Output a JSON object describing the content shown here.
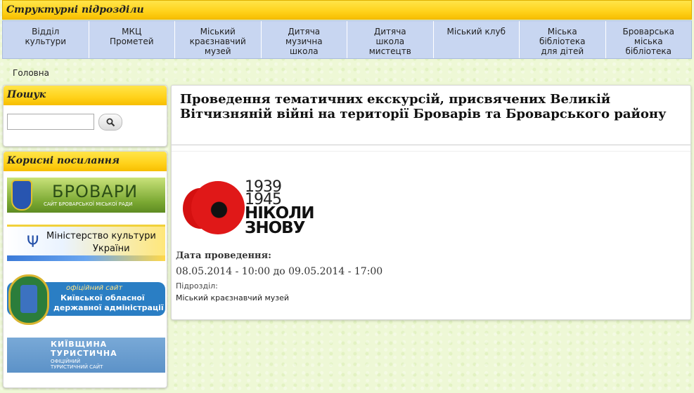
{
  "header": {
    "title": "Структурні підрозділи"
  },
  "nav": [
    [
      "Відділ",
      "культури"
    ],
    [
      "МКЦ",
      "Прометей"
    ],
    [
      "Міський",
      "краєзнавчий",
      "музей"
    ],
    [
      "Дитяча",
      "музична",
      "школа"
    ],
    [
      "Дитяча",
      "школа",
      "мистецтв"
    ],
    [
      "Міський клуб"
    ],
    [
      "Міська",
      "бібліотека",
      "для дітей"
    ],
    [
      "Броварська",
      "міська",
      "бібліотека"
    ]
  ],
  "breadcrumb": "Головна",
  "search": {
    "title": "Пошук",
    "value": "",
    "placeholder": "",
    "icon": "search-icon"
  },
  "links": {
    "title": "Корисні посилання",
    "brovary": {
      "big": "БРОВАРИ",
      "small": "САЙТ БРОВАРСЬКОЇ МІСЬКОЇ РАДИ"
    },
    "ministry": {
      "line1": "Міністерство культури",
      "line2": "України"
    },
    "kyiv": {
      "line1": "офіційний сайт",
      "line2": "Київської обласної",
      "line3": "державної адміністрації"
    },
    "tourism": {
      "line1": "КИЇВЩИНА",
      "line2": "ТУРИСТИЧНА",
      "line3": "ОФІЦІЙНИЙ",
      "line4": "ТУРИСТИЧНИЙ САЙТ"
    }
  },
  "article": {
    "title": "Проведення тематичних екскурсій, присвячених Великій Вітчизняній війні на території Броварів та Броварського району",
    "poster": {
      "year1": "1939",
      "year2": "1945",
      "slogan1": "НІКОЛИ",
      "slogan2": "ЗНОВУ"
    },
    "date_label": "Дата проведення:",
    "date_value": "08.05.2014 - 10:00 до 09.05.2014 - 17:00",
    "unit_label": "Підрозділ:",
    "unit_value": "Міський краєзнавчий музей"
  },
  "colors": {
    "accent_yellow": "#ffd21a",
    "nav_blue": "#c8d6f1",
    "page_green": "#eef8d6"
  }
}
